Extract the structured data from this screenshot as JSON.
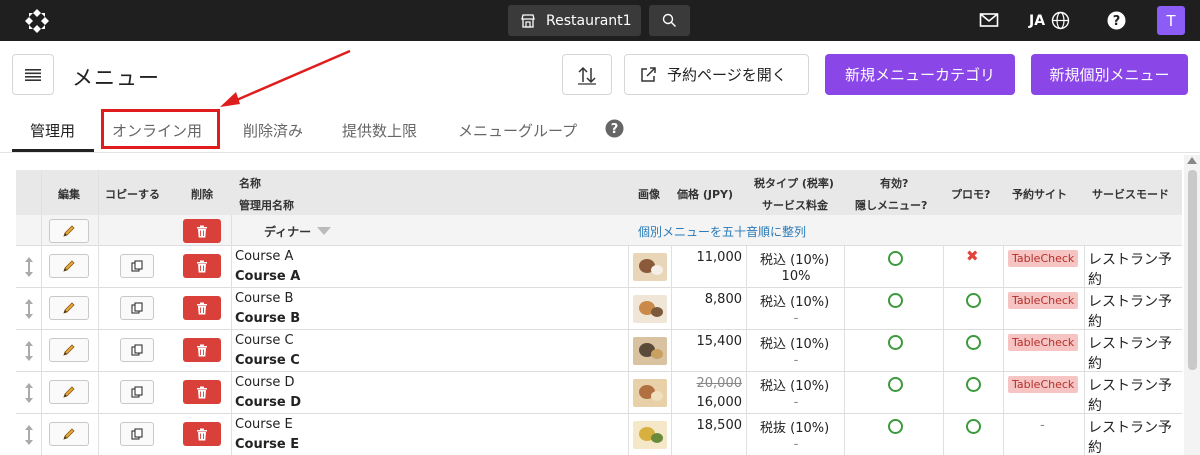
{
  "topbar": {
    "store_name": "Restaurant1",
    "language": "JA",
    "avatar_initial": "T"
  },
  "header": {
    "title": "メニュー",
    "open_booking_label": "予約ページを開く",
    "new_category_label": "新規メニューカテゴリ",
    "new_item_label": "新規個別メニュー"
  },
  "tabs": [
    {
      "label": "管理用"
    },
    {
      "label": "オンライン用"
    },
    {
      "label": "削除済み"
    },
    {
      "label": "提供数上限"
    },
    {
      "label": "メニューグループ"
    }
  ],
  "table": {
    "headers": {
      "edit": "編集",
      "copy": "コピーする",
      "delete": "削除",
      "name": "名称",
      "admin_name": "管理用名称",
      "image": "画像",
      "price": "価格 (JPY)",
      "tax": "税タイプ (税率)",
      "service_fee": "サービス料金",
      "active": "有効?",
      "hidden": "隠しメニュー?",
      "promo": "プロモ?",
      "booking_site": "予約サイト",
      "service_mode": "サービスモード"
    },
    "category": {
      "name": "ディナー",
      "sort_link": "個別メニューを五十音順に整列"
    },
    "rows": [
      {
        "name": "Course A",
        "admin_name": "Course A",
        "price": "11,000",
        "price_original": "",
        "tax": "税込 (10%)",
        "service": "10%",
        "promo": "no",
        "booking": "TableCheck",
        "mode_1": "レストラン予",
        "mode_2": "約"
      },
      {
        "name": "Course B",
        "admin_name": "Course B",
        "price": "8,800",
        "price_original": "",
        "tax": "税込 (10%)",
        "service": "-",
        "promo": "yes",
        "booking": "TableCheck",
        "mode_1": "レストラン予",
        "mode_2": "約"
      },
      {
        "name": "Course C",
        "admin_name": "Course C",
        "price": "15,400",
        "price_original": "",
        "tax": "税込 (10%)",
        "service": "-",
        "promo": "yes",
        "booking": "TableCheck",
        "mode_1": "レストラン予",
        "mode_2": "約"
      },
      {
        "name": "Course D",
        "admin_name": "Course D",
        "price": "16,000",
        "price_original": "20,000",
        "tax": "税込 (10%)",
        "service": "-",
        "promo": "yes",
        "booking": "TableCheck",
        "mode_1": "レストラン予",
        "mode_2": "約"
      },
      {
        "name": "Course E",
        "admin_name": "Course E",
        "price": "18,500",
        "price_original": "",
        "tax": "税抜 (10%)",
        "service": "-",
        "promo": "yes",
        "booking": "-",
        "mode_1": "レストラン予",
        "mode_2": "約"
      }
    ]
  },
  "colors": {
    "accent": "#8b46e8",
    "topbar": "#1f1f1f",
    "delete": "#d9403a",
    "highlight": "#e01d1d",
    "ok": "#3c9a3c"
  }
}
